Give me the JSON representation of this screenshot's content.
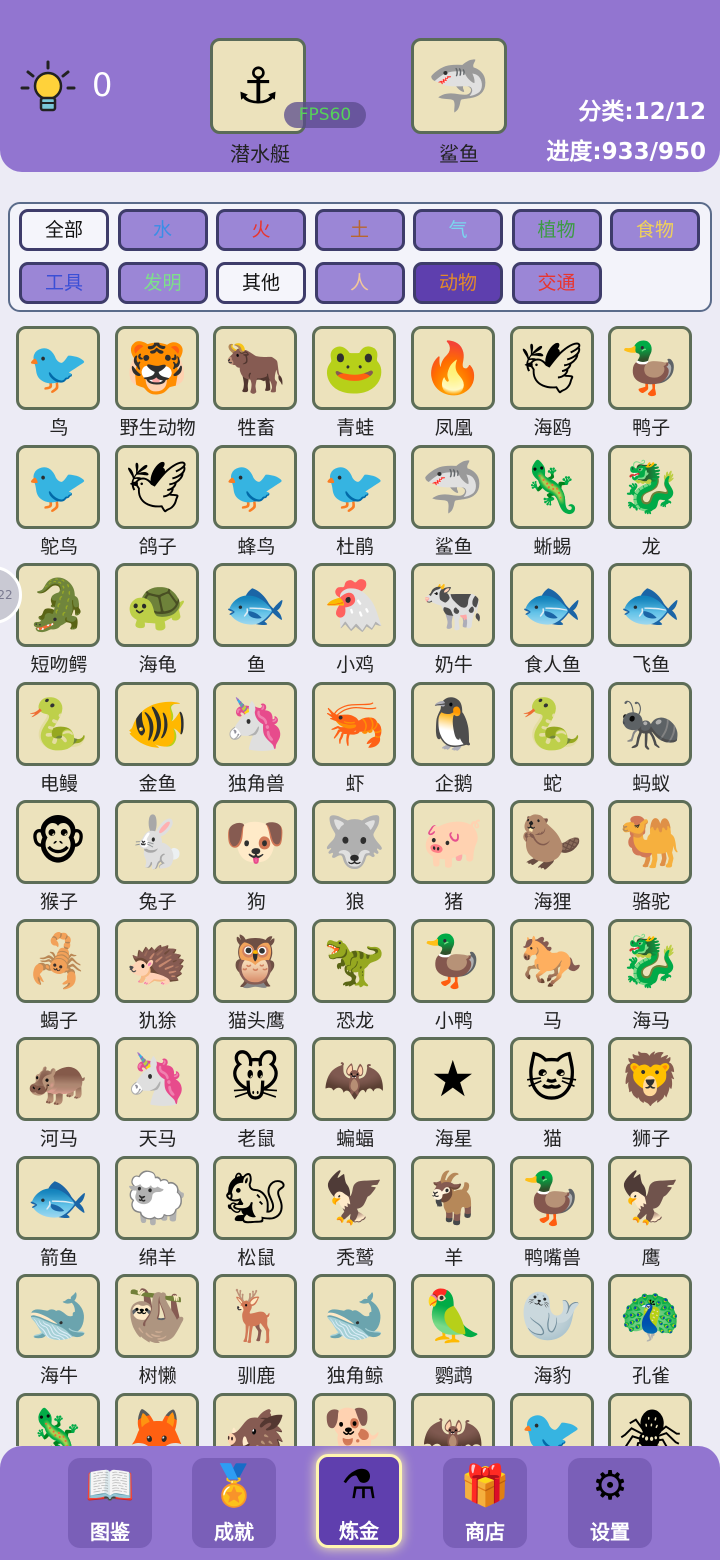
{
  "hud": {
    "hint_count": "0",
    "slot_left": {
      "icon": "submarine-icon",
      "glyph": "⚓",
      "label": "潜水艇"
    },
    "slot_right": {
      "icon": "shark-icon",
      "glyph": "🦈",
      "label": "鲨鱼"
    },
    "fps": "FPS60",
    "category_stat": "分类:12/12",
    "progress_stat": "进度:933/950"
  },
  "categories": [
    {
      "label": "全部",
      "color": "#111111",
      "style": "white",
      "slug": "all"
    },
    {
      "label": "水",
      "color": "#3a8ee6",
      "style": "purple",
      "slug": "water"
    },
    {
      "label": "火",
      "color": "#e8352e",
      "style": "purple",
      "slug": "fire"
    },
    {
      "label": "土",
      "color": "#b8672e",
      "style": "purple",
      "slug": "earth"
    },
    {
      "label": "气",
      "color": "#7ad6ef",
      "style": "purple",
      "slug": "air"
    },
    {
      "label": "植物",
      "color": "#3d9a45",
      "style": "purple",
      "slug": "plants"
    },
    {
      "label": "食物",
      "color": "#f0d15a",
      "style": "purple",
      "slug": "food"
    },
    {
      "label": "工具",
      "color": "#3b4fd6",
      "style": "purple",
      "slug": "tools"
    },
    {
      "label": "发明",
      "color": "#7de08a",
      "style": "purple",
      "slug": "invention"
    },
    {
      "label": "其他",
      "color": "#111111",
      "style": "white",
      "slug": "other"
    },
    {
      "label": "人",
      "color": "#f2c79a",
      "style": "purple",
      "slug": "people"
    },
    {
      "label": "动物",
      "color": "#e38a2a",
      "style": "active",
      "slug": "animals"
    },
    {
      "label": "交通",
      "color": "#e8352e",
      "style": "purple",
      "slug": "transport"
    }
  ],
  "animals": [
    {
      "name": "鸟",
      "icon": "bird-icon",
      "glyph": "🐦"
    },
    {
      "name": "野生动物",
      "icon": "tiger-icon",
      "glyph": "🐯"
    },
    {
      "name": "牲畜",
      "icon": "ox-icon",
      "glyph": "🐂"
    },
    {
      "name": "青蛙",
      "icon": "frog-icon",
      "glyph": "🐸"
    },
    {
      "name": "凤凰",
      "icon": "phoenix-icon",
      "glyph": "🔥"
    },
    {
      "name": "海鸥",
      "icon": "seagull-icon",
      "glyph": "🕊"
    },
    {
      "name": "鸭子",
      "icon": "duck-icon",
      "glyph": "🦆"
    },
    {
      "name": "鸵鸟",
      "icon": "ostrich-icon",
      "glyph": "🐦"
    },
    {
      "name": "鸽子",
      "icon": "pigeon-icon",
      "glyph": "🕊"
    },
    {
      "name": "蜂鸟",
      "icon": "hummingbird-icon",
      "glyph": "🐦"
    },
    {
      "name": "杜鹃",
      "icon": "cuckoo-icon",
      "glyph": "🐦"
    },
    {
      "name": "鲨鱼",
      "icon": "shark-icon",
      "glyph": "🦈"
    },
    {
      "name": "蜥蜴",
      "icon": "lizard-icon",
      "glyph": "🦎"
    },
    {
      "name": "龙",
      "icon": "dragon-icon",
      "glyph": "🐉"
    },
    {
      "name": "短吻鳄",
      "icon": "alligator-icon",
      "glyph": "🐊"
    },
    {
      "name": "海龟",
      "icon": "sea-turtle-icon",
      "glyph": "🐢"
    },
    {
      "name": "鱼",
      "icon": "fish-icon",
      "glyph": "🐟"
    },
    {
      "name": "小鸡",
      "icon": "chicken-icon",
      "glyph": "🐔"
    },
    {
      "name": "奶牛",
      "icon": "cow-icon",
      "glyph": "🐄"
    },
    {
      "name": "食人鱼",
      "icon": "piranha-icon",
      "glyph": "🐟"
    },
    {
      "name": "飞鱼",
      "icon": "flying-fish-icon",
      "glyph": "🐟"
    },
    {
      "name": "电鳗",
      "icon": "eel-icon",
      "glyph": "🐍"
    },
    {
      "name": "金鱼",
      "icon": "goldfish-icon",
      "glyph": "🐠"
    },
    {
      "name": "独角兽",
      "icon": "unicorn-icon",
      "glyph": "🦄"
    },
    {
      "name": "虾",
      "icon": "shrimp-icon",
      "glyph": "🦐"
    },
    {
      "name": "企鹅",
      "icon": "penguin-icon",
      "glyph": "🐧"
    },
    {
      "name": "蛇",
      "icon": "snake-icon",
      "glyph": "🐍"
    },
    {
      "name": "蚂蚁",
      "icon": "ant-icon",
      "glyph": "🐜"
    },
    {
      "name": "猴子",
      "icon": "monkey-icon",
      "glyph": "🐵"
    },
    {
      "name": "兔子",
      "icon": "rabbit-icon",
      "glyph": "🐇"
    },
    {
      "name": "狗",
      "icon": "dog-icon",
      "glyph": "🐶"
    },
    {
      "name": "狼",
      "icon": "wolf-icon",
      "glyph": "🐺"
    },
    {
      "name": "猪",
      "icon": "pig-icon",
      "glyph": "🐖"
    },
    {
      "name": "海狸",
      "icon": "beaver-icon",
      "glyph": "🦫"
    },
    {
      "name": "骆驼",
      "icon": "camel-icon",
      "glyph": "🐫"
    },
    {
      "name": "蝎子",
      "icon": "scorpion-icon",
      "glyph": "🦂"
    },
    {
      "name": "犰狳",
      "icon": "armadillo-icon",
      "glyph": "🦔"
    },
    {
      "name": "猫头鹰",
      "icon": "owl-icon",
      "glyph": "🦉"
    },
    {
      "name": "恐龙",
      "icon": "dinosaur-icon",
      "glyph": "🦖"
    },
    {
      "name": "小鸭",
      "icon": "duckling-icon",
      "glyph": "🦆"
    },
    {
      "name": "马",
      "icon": "horse-icon",
      "glyph": "🐎"
    },
    {
      "name": "海马",
      "icon": "seahorse-icon",
      "glyph": "🐉"
    },
    {
      "name": "河马",
      "icon": "hippo-icon",
      "glyph": "🦛"
    },
    {
      "name": "天马",
      "icon": "pegasus-icon",
      "glyph": "🦄"
    },
    {
      "name": "老鼠",
      "icon": "mouse-icon",
      "glyph": "🐭"
    },
    {
      "name": "蝙蝠",
      "icon": "bat-icon",
      "glyph": "🦇"
    },
    {
      "name": "海星",
      "icon": "starfish-icon",
      "glyph": "★"
    },
    {
      "name": "猫",
      "icon": "cat-icon",
      "glyph": "🐱"
    },
    {
      "name": "狮子",
      "icon": "lion-icon",
      "glyph": "🦁"
    },
    {
      "name": "箭鱼",
      "icon": "swordfish-icon",
      "glyph": "🐟"
    },
    {
      "name": "绵羊",
      "icon": "sheep-icon",
      "glyph": "🐑"
    },
    {
      "name": "松鼠",
      "icon": "squirrel-icon",
      "glyph": "🐿"
    },
    {
      "name": "秃鹫",
      "icon": "vulture-icon",
      "glyph": "🦅"
    },
    {
      "name": "羊",
      "icon": "goat-icon",
      "glyph": "🐐"
    },
    {
      "name": "鸭嘴兽",
      "icon": "platypus-icon",
      "glyph": "🦆"
    },
    {
      "name": "鹰",
      "icon": "eagle-icon",
      "glyph": "🦅"
    },
    {
      "name": "海牛",
      "icon": "manatee-icon",
      "glyph": "🐋"
    },
    {
      "name": "树懒",
      "icon": "sloth-icon",
      "glyph": "🦥"
    },
    {
      "name": "驯鹿",
      "icon": "reindeer-icon",
      "glyph": "🦌"
    },
    {
      "name": "独角鲸",
      "icon": "narwhal-icon",
      "glyph": "🐋"
    },
    {
      "name": "鹦鹉",
      "icon": "parrot-icon",
      "glyph": "🦜"
    },
    {
      "name": "海豹",
      "icon": "seal-icon",
      "glyph": "🦭"
    },
    {
      "name": "孔雀",
      "icon": "peacock-icon",
      "glyph": "🦚"
    },
    {
      "name": "",
      "icon": "chameleon-icon",
      "glyph": "🦎"
    },
    {
      "name": "",
      "icon": "fox-icon",
      "glyph": "🦊"
    },
    {
      "name": "",
      "icon": "boar-icon",
      "glyph": "🐗"
    },
    {
      "name": "",
      "icon": "shiba-icon",
      "glyph": "🐕"
    },
    {
      "name": "",
      "icon": "pterodactyl-icon",
      "glyph": "🦇"
    },
    {
      "name": "",
      "icon": "woodpecker-icon",
      "glyph": "🐦"
    },
    {
      "name": "",
      "icon": "spider-icon",
      "glyph": "🕷"
    }
  ],
  "side_tab_text": "22",
  "nav": [
    {
      "label": "图鉴",
      "icon": "book-icon",
      "glyph": "📖",
      "slug": "encyclopedia"
    },
    {
      "label": "成就",
      "icon": "medal-icon",
      "glyph": "🏅",
      "slug": "achievements"
    },
    {
      "label": "炼金",
      "icon": "flask-icon",
      "glyph": "⚗",
      "slug": "alchemy",
      "active": true
    },
    {
      "label": "商店",
      "icon": "gift-icon",
      "glyph": "🎁",
      "slug": "shop"
    },
    {
      "label": "设置",
      "icon": "gear-icon",
      "glyph": "⚙",
      "slug": "settings"
    }
  ]
}
